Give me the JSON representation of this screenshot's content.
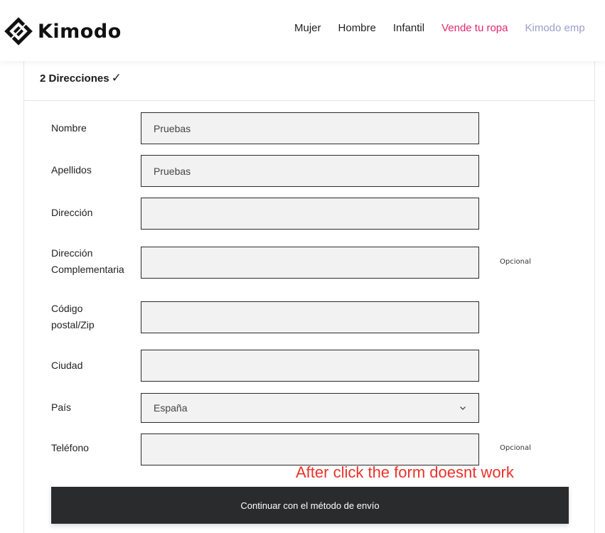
{
  "header": {
    "brand": "Kimodo",
    "nav": [
      {
        "label": "Mujer",
        "style": "normal"
      },
      {
        "label": "Hombre",
        "style": "normal"
      },
      {
        "label": "Infantil",
        "style": "normal"
      },
      {
        "label": "Vende tu ropa",
        "style": "pink"
      },
      {
        "label": "Kimodo emp",
        "style": "lav"
      }
    ]
  },
  "section": {
    "title": "2 Direcciones",
    "check_icon": "✓"
  },
  "form": {
    "nombre": {
      "label": "Nombre",
      "value": "Pruebas"
    },
    "apellidos": {
      "label": "Apellidos",
      "value": "Pruebas"
    },
    "direccion": {
      "label": "Dirección",
      "value": ""
    },
    "direccion_comp": {
      "label_line1": "Dirección",
      "label_line2": "Complementaria",
      "value": "",
      "note": "Opcional"
    },
    "codigo_postal": {
      "label_line1": "Código",
      "label_line2": "postal/Zip",
      "value": ""
    },
    "ciudad": {
      "label": "Ciudad",
      "value": ""
    },
    "pais": {
      "label": "País",
      "value": "España"
    },
    "telefono": {
      "label": "Teléfono",
      "value": "",
      "note": "Opcional"
    }
  },
  "annotation": "After click the form doesnt work",
  "submit_label": "Continuar con el método de envío",
  "colors": {
    "accent_pink": "#e3286f",
    "annotation_red": "#e8332b",
    "button_dark": "#2a2b2d"
  }
}
